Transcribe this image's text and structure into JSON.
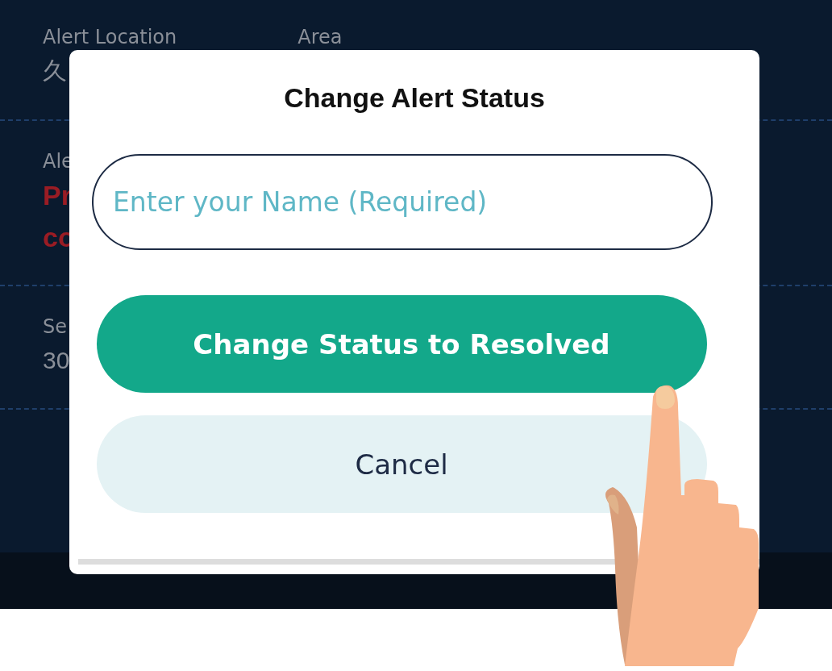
{
  "background": {
    "rows": [
      {
        "label": "Alert Location",
        "value": "久",
        "label_2": "Area"
      },
      {
        "label": "Ale",
        "value": "Pr",
        "value_2": "co"
      },
      {
        "label": "Se",
        "value": "30"
      }
    ]
  },
  "dialog": {
    "title": "Change Alert Status",
    "name_field": {
      "placeholder": "Enter your Name (Required)"
    },
    "buttons": [
      {
        "label": "Change Status to Resolved",
        "kind": "primary"
      },
      {
        "label": "Cancel",
        "kind": "secondary"
      }
    ]
  }
}
